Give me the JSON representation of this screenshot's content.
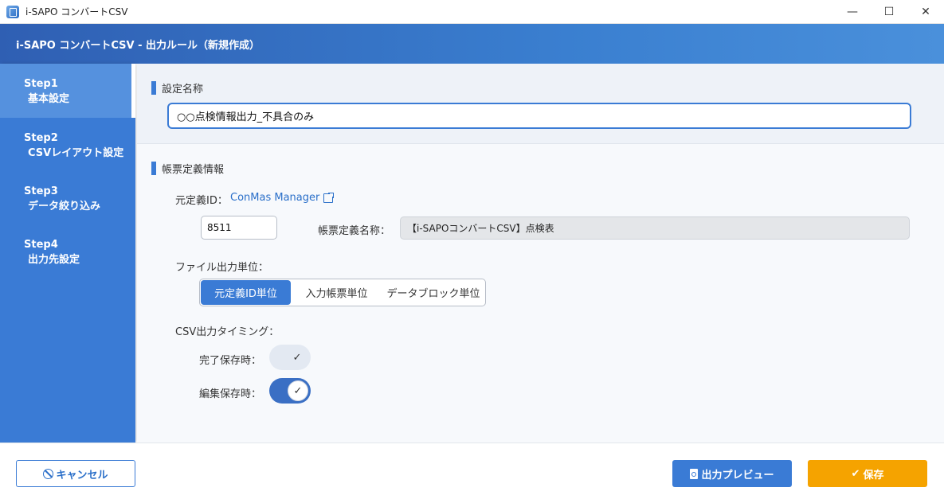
{
  "window": {
    "title": "i-SAPO コンバートCSV",
    "minimize_glyph": "—",
    "maximize_glyph": "☐",
    "close_glyph": "✕"
  },
  "header": {
    "title": "i-SAPO コンバートCSV - 出力ルール（新規作成）"
  },
  "sidebar": {
    "steps": [
      {
        "num": "Step1",
        "label": "基本設定",
        "active": true
      },
      {
        "num": "Step2",
        "label": "CSVレイアウト設定",
        "active": false
      },
      {
        "num": "Step3",
        "label": "データ絞り込み",
        "active": false
      },
      {
        "num": "Step4",
        "label": "出力先設定",
        "active": false
      }
    ]
  },
  "setting_name": {
    "title": "設定名称",
    "value": "○○点検情報出力_不具合のみ"
  },
  "form_definition": {
    "title": "帳票定義情報",
    "source_id_label": "元定義ID：",
    "link_text": "ConMas Manager",
    "id_value": "8511",
    "form_name_label": "帳票定義名称：",
    "form_name_value": "【i-SAPOコンバートCSV】点検表",
    "file_unit_label": "ファイル出力単位：",
    "unit_options": [
      "元定義ID単位",
      "入力帳票単位",
      "データブロック単位"
    ],
    "selected_unit": "元定義ID単位",
    "timing_label": "CSV出力タイミング：",
    "timing": [
      {
        "label": "完了保存時：",
        "on": false
      },
      {
        "label": "編集保存時：",
        "on": true
      }
    ],
    "check_glyph": "✓"
  },
  "footer": {
    "cancel_label": "キャンセル",
    "preview_label": "出力プレビュー",
    "save_label": "保存",
    "save_glyph": "✔"
  },
  "colors": {
    "accent": "#3a7bd5",
    "save": "#f5a300",
    "header_start": "#2f5fb3",
    "header_end": "#4a90db"
  }
}
